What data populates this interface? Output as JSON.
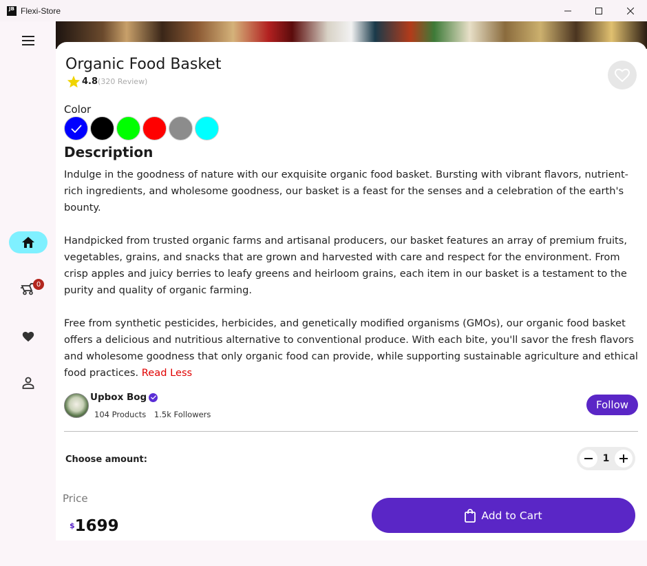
{
  "window": {
    "app_icon_text": "JB",
    "title": "Flexi-Store"
  },
  "sidebar": {
    "items": [
      {
        "name": "home",
        "icon": "home-icon",
        "active": true
      },
      {
        "name": "cart",
        "icon": "delivery-cart-icon",
        "badge": "0"
      },
      {
        "name": "favorites",
        "icon": "heart-icon"
      },
      {
        "name": "profile",
        "icon": "person-icon"
      }
    ],
    "accent": "#7ff0ff"
  },
  "product": {
    "title": "Organic Food Basket",
    "rating": "4.8",
    "reviews": "(320 Review)",
    "color_label": "Color",
    "colors": [
      "#0000ff",
      "#000000",
      "#00ff00",
      "#ff0000",
      "#8c8c8c",
      "#00ffff"
    ],
    "selected_color_index": 0
  },
  "description": {
    "heading": "Description",
    "paragraphs": [
      "Indulge in the goodness of nature with our exquisite organic food basket. Bursting with vibrant flavors, nutrient-rich ingredients, and wholesome goodness, our basket is a feast for the senses and a celebration of the earth's bounty.",
      "Handpicked from trusted organic farms and artisanal producers, our basket features an array of premium fruits, vegetables, grains, and snacks that are grown and harvested with care and respect for the environment. From crisp apples and juicy berries to leafy greens and heirloom grains, each item in our basket is a testament to the purity and quality of organic farming.",
      "Free from synthetic pesticides, herbicides, and genetically modified organisms (GMOs), our organic food basket offers a delicious and nutritious alternative to conventional produce. With each bite, you'll savor the fresh flavors and wholesome goodness that only organic food can provide, while supporting sustainable agriculture and ethical food practices."
    ],
    "read_less": "Read Less"
  },
  "seller": {
    "name": "Upbox Bog",
    "products": "104 Products",
    "followers": "1.5k Followers",
    "follow_label": "Follow"
  },
  "amount": {
    "label": "Choose amount:",
    "quantity": "1"
  },
  "price": {
    "label": "Price",
    "currency": "$",
    "value": "1699"
  },
  "cart": {
    "add_label": "Add to Cart"
  },
  "colors": {
    "primary": "#5a26c6",
    "read_less": "#e00000",
    "badge": "#b3261e"
  }
}
